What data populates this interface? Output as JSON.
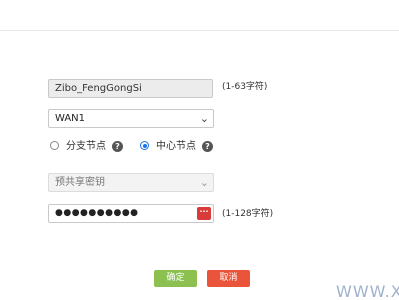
{
  "form": {
    "name_value": "Zibo_FengGongSi",
    "name_hint": "(1-63字符)",
    "interface_value": "WAN1",
    "role_options": {
      "branch_label": "分支节点",
      "center_label": "中心节点",
      "selected": "中心节点"
    },
    "help_glyph": "?",
    "auth_value": "预共享密钥",
    "key_mask": "●●●●●●●●●●",
    "key_hint": "(1-128字符)",
    "show_key_glyph": "···"
  },
  "actions": {
    "ok_label": "确定",
    "cancel_label": "取消"
  },
  "watermark": "WWW.X",
  "colors": {
    "ok": "#8cc152",
    "cancel": "#e9543b",
    "radio_selected": "#1a73e8",
    "password_toggle": "#d93a3a"
  }
}
